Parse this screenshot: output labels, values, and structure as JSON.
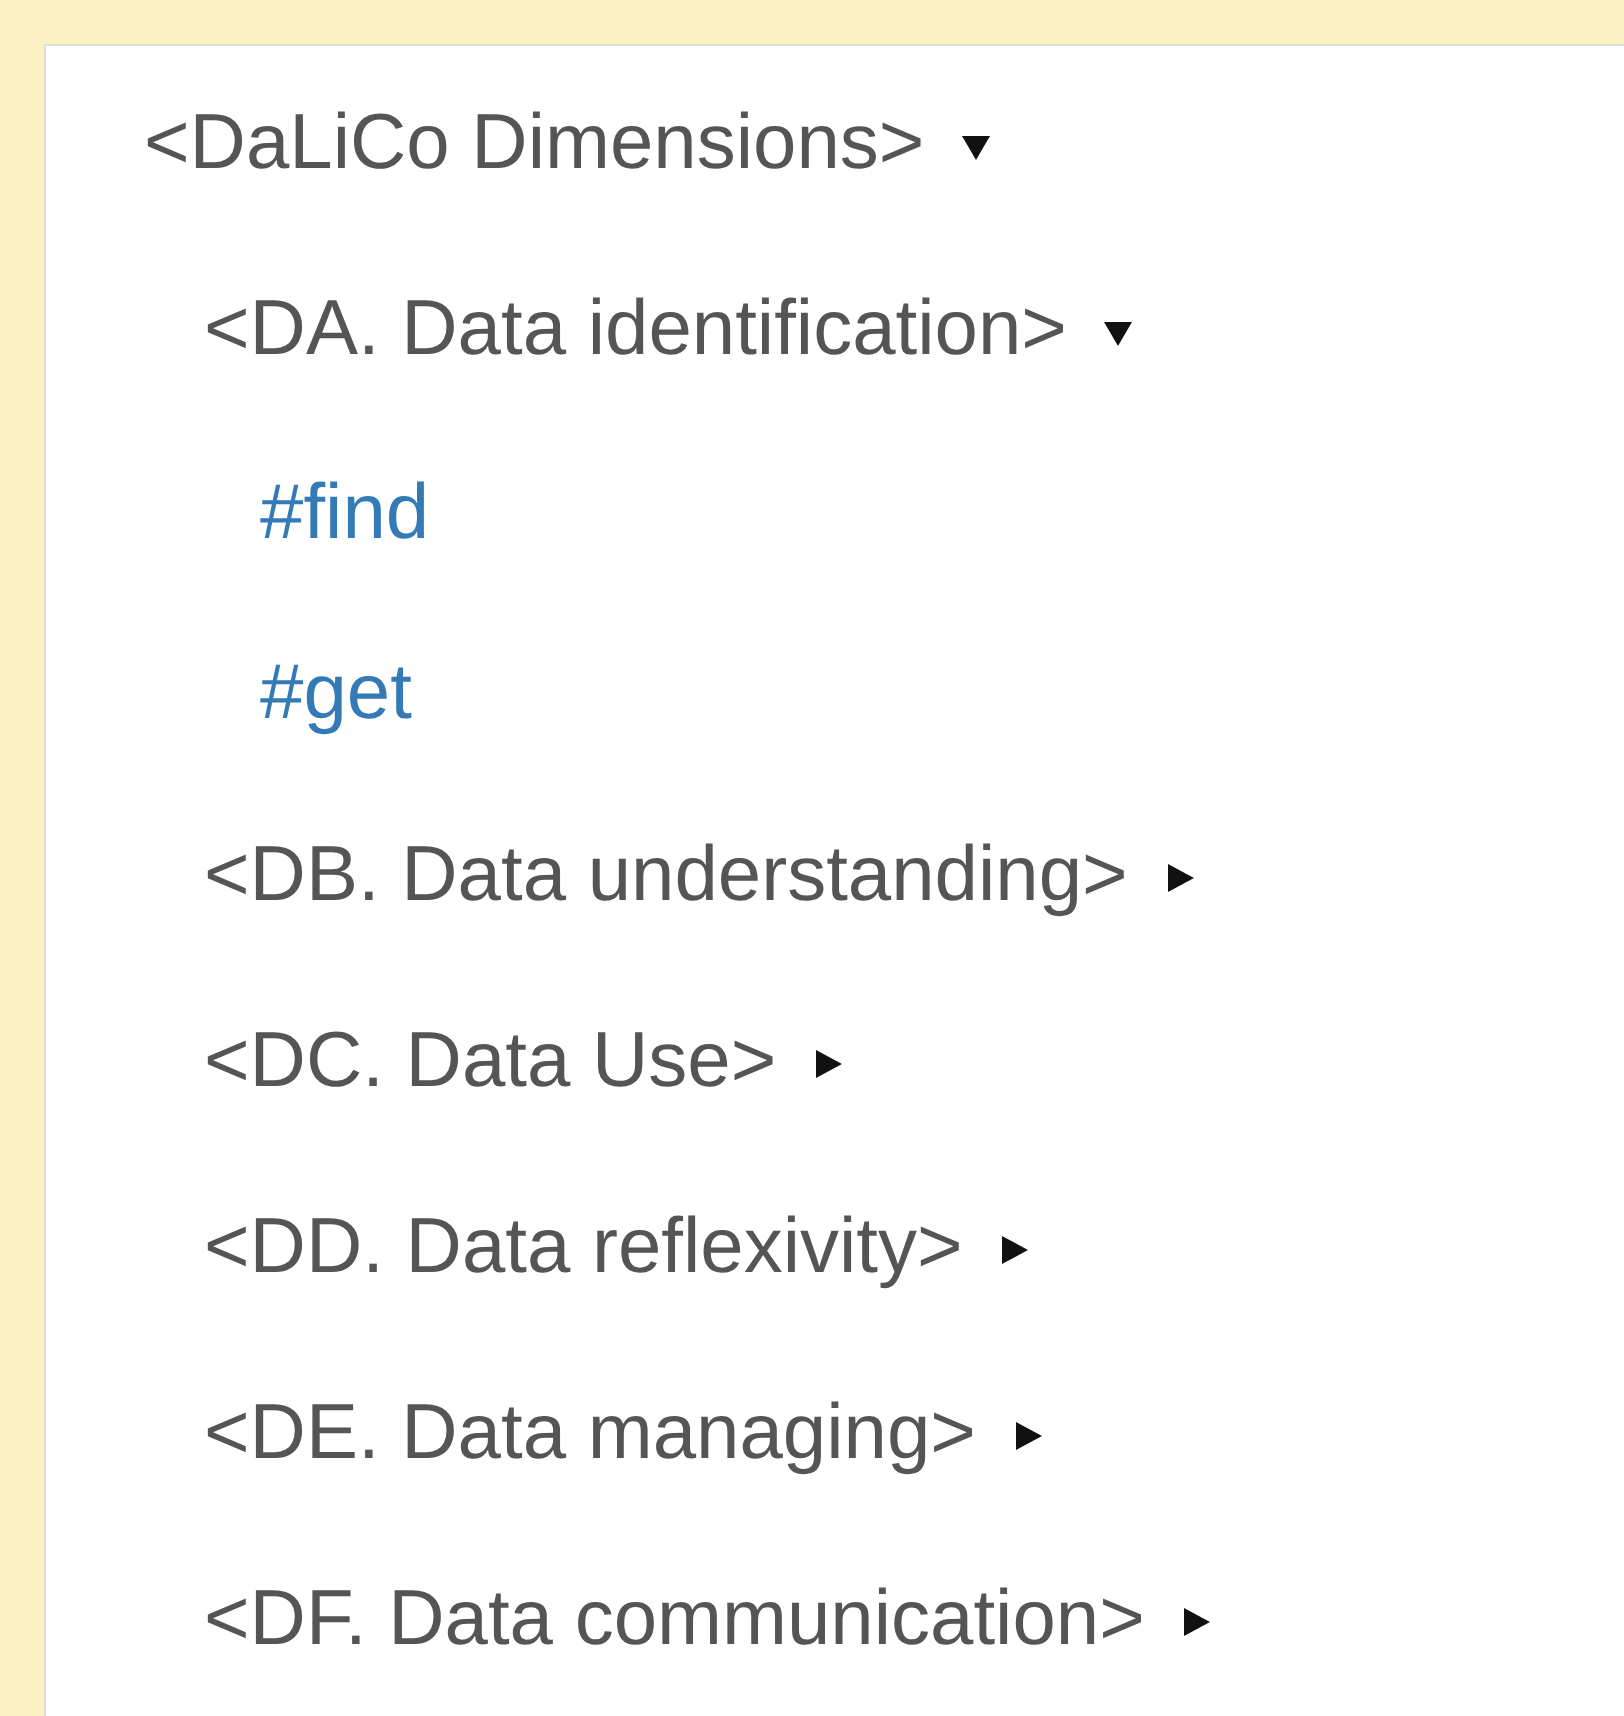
{
  "tree": [
    {
      "label": "<DaLiCo Dimensions>",
      "kind": "group",
      "expanded": true,
      "children": [
        {
          "label": "<DA. Data identification>",
          "kind": "group",
          "expanded": true,
          "children": [
            {
              "label": "#find",
              "kind": "tag"
            },
            {
              "label": "#get",
              "kind": "tag"
            }
          ]
        },
        {
          "label": "<DB. Data understanding>",
          "kind": "group",
          "expanded": false
        },
        {
          "label": "<DC. Data Use>",
          "kind": "group",
          "expanded": false
        },
        {
          "label": "<DD. Data reflexivity>",
          "kind": "group",
          "expanded": false
        },
        {
          "label": "<DE. Data managing>",
          "kind": "group",
          "expanded": false
        },
        {
          "label": "<DF. Data communication>",
          "kind": "group",
          "expanded": false
        }
      ]
    }
  ]
}
